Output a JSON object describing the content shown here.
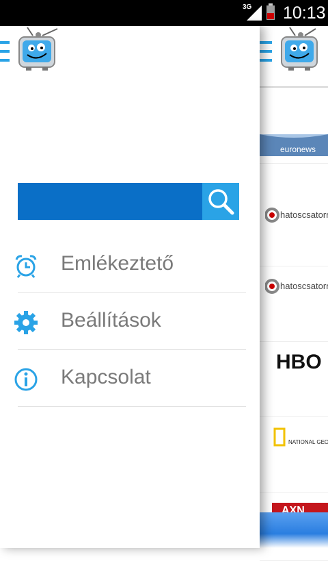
{
  "status_bar": {
    "network": "3G",
    "time": "10:13"
  },
  "drawer": {
    "search": {
      "value": "",
      "placeholder": ""
    },
    "menu": [
      {
        "label": "Emlékeztető",
        "icon": "alarm-clock-icon"
      },
      {
        "label": "Beállítások",
        "icon": "gear-icon"
      },
      {
        "label": "Kapcsolat",
        "icon": "info-icon"
      }
    ]
  },
  "channels": [
    {
      "name": "euronews",
      "logo": "euronews-logo"
    },
    {
      "name": "hatoscsatorna",
      "logo": "hatoscsatorna-logo"
    },
    {
      "name": "hatoscsatorna",
      "logo": "hatoscsatorna-logo"
    },
    {
      "name": "HBO",
      "logo": "hbo-logo"
    },
    {
      "name": "NATIONAL GEOGRAPHIC CHANNEL",
      "logo": "natgeo-logo"
    },
    {
      "name": "AXN",
      "logo": "axn-logo"
    }
  ],
  "colors": {
    "accent": "#2aa3e6",
    "search_field": "#0a6fc7",
    "menu_text": "#7a7a7a"
  }
}
